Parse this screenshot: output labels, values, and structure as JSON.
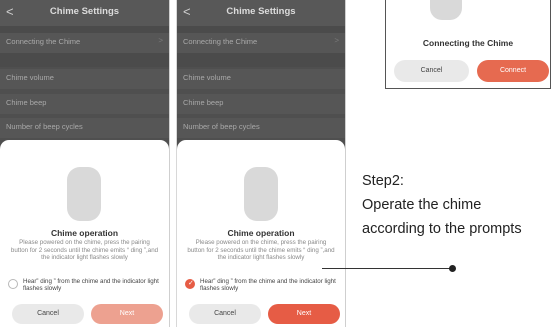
{
  "phones": [
    {
      "nav": {
        "back_icon": "<",
        "title": "Chime Settings"
      },
      "rows": [
        {
          "label": "Connecting the Chime",
          "chevron": ">"
        },
        {
          "label": "Chime volume",
          "chevron": ""
        },
        {
          "label": "Chime beep",
          "chevron": ""
        },
        {
          "label": "Number of beep cycles",
          "chevron": ""
        }
      ],
      "sheet": {
        "heading": "Chime operation",
        "description": "Please powered on the chime, press the pairing button for 2 seconds until the chime emits “ ding ”,and the indicator light flashes slowly",
        "confirm_text": "Hear” ding ” from the chime  and the indicator light flashes slowly",
        "confirm_checked": false,
        "cancel_label": "Cancel",
        "next_label": "Next",
        "next_enabled": false
      }
    },
    {
      "nav": {
        "back_icon": "<",
        "title": "Chime Settings"
      },
      "rows": [
        {
          "label": "Connecting the Chime",
          "chevron": ">"
        },
        {
          "label": "Chime volume",
          "chevron": ""
        },
        {
          "label": "Chime beep",
          "chevron": ""
        },
        {
          "label": "Number of beep cycles",
          "chevron": ""
        }
      ],
      "sheet": {
        "heading": "Chime operation",
        "description": "Please powered on the chime, press the pairing button for 2 seconds until the chime emits “ ding ”,and the indicator light flashes slowly",
        "confirm_text": "Hear” ding ” from the chime  and the indicator light flashes slowly",
        "confirm_checked": true,
        "cancel_label": "Cancel",
        "next_label": "Next",
        "next_enabled": true
      }
    }
  ],
  "corner_card": {
    "heading": "Connecting the Chime",
    "cancel_label": "Cancel",
    "connect_label": "Connect"
  },
  "annotation": {
    "step_label": "Step2:",
    "line1": "Operate the chime",
    "line2": "according to the prompts"
  },
  "colors": {
    "accent": "#e65c45",
    "accent_disabled": "#eda190",
    "overlay": "#4f4f4f"
  }
}
